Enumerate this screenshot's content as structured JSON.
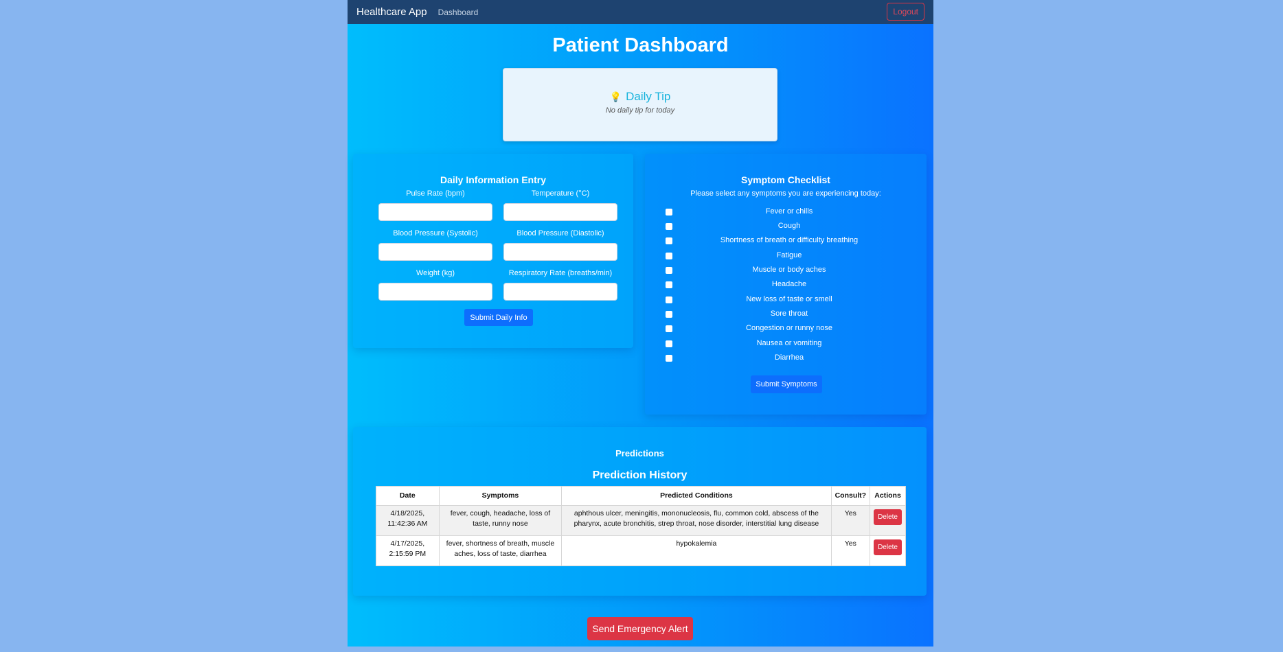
{
  "navbar": {
    "brand": "Healthcare App",
    "dashboard_link": "Dashboard",
    "logout_label": "Logout"
  },
  "page_title": "Patient Dashboard",
  "daily_tip": {
    "icon": "lightbulb-icon",
    "title": "Daily Tip",
    "text": "No daily tip for today"
  },
  "daily_entry": {
    "title": "Daily Information Entry",
    "fields": [
      {
        "label": "Pulse Rate (bpm)",
        "value": ""
      },
      {
        "label": "Temperature (°C)",
        "value": ""
      },
      {
        "label": "Blood Pressure (Systolic)",
        "value": ""
      },
      {
        "label": "Blood Pressure (Diastolic)",
        "value": ""
      },
      {
        "label": "Weight (kg)",
        "value": ""
      },
      {
        "label": "Respiratory Rate (breaths/min)",
        "value": ""
      }
    ],
    "submit_label": "Submit Daily Info"
  },
  "symptom_checklist": {
    "title": "Symptom Checklist",
    "subtitle": "Please select any symptoms you are experiencing today:",
    "items": [
      {
        "label": "Fever or chills",
        "checked": false
      },
      {
        "label": "Cough",
        "checked": false
      },
      {
        "label": "Shortness of breath or difficulty breathing",
        "checked": false
      },
      {
        "label": "Fatigue",
        "checked": false
      },
      {
        "label": "Muscle or body aches",
        "checked": false
      },
      {
        "label": "Headache",
        "checked": false
      },
      {
        "label": "New loss of taste or smell",
        "checked": false
      },
      {
        "label": "Sore throat",
        "checked": false
      },
      {
        "label": "Congestion or runny nose",
        "checked": false
      },
      {
        "label": "Nausea or vomiting",
        "checked": false
      },
      {
        "label": "Diarrhea",
        "checked": false
      }
    ],
    "submit_label": "Submit Symptoms"
  },
  "predictions": {
    "heading": "Predictions",
    "history_title": "Prediction History",
    "columns": [
      "Date",
      "Symptoms",
      "Predicted Conditions",
      "Consult?",
      "Actions"
    ],
    "rows": [
      {
        "date": "4/18/2025, 11:42:36 AM",
        "symptoms": "fever, cough, headache, loss of taste, runny nose",
        "conditions": "aphthous ulcer, meningitis, mononucleosis, flu, common cold, abscess of the pharynx, acute bronchitis, strep throat, nose disorder, interstitial lung disease",
        "consult": "Yes",
        "action": "Delete"
      },
      {
        "date": "4/17/2025, 2:15:59 PM",
        "symptoms": "fever, shortness of breath, muscle aches, loss of taste, diarrhea",
        "conditions": "hypokalemia",
        "consult": "Yes",
        "action": "Delete"
      }
    ]
  },
  "emergency_label": "Send Emergency Alert",
  "colors": {
    "page_bg": "#87b5f0",
    "navbar": "#1e4370",
    "primary": "#0d6efd",
    "danger": "#dc3545",
    "tip_title": "#17b3dc"
  }
}
